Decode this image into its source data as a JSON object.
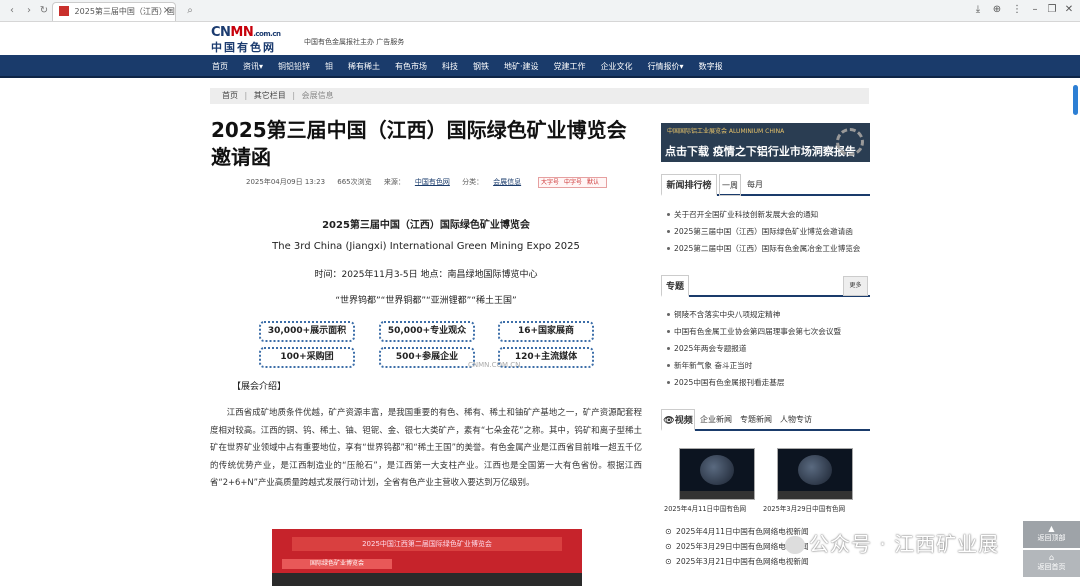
{
  "browser": {
    "tab_title": "2025第三届中国（江西）国际",
    "back_icon": "‹",
    "forward_icon": "›",
    "reload_icon": "↻",
    "search_icon": "⌕",
    "close_tab": "×",
    "download_icon": "⤓",
    "globe_icon": "⊕",
    "menu_icon": "⋮",
    "minimize": "–",
    "restore": "❐",
    "close": "✕"
  },
  "header": {
    "logo_main_a": "CN",
    "logo_main_b": "MN",
    "logo_suffix": ".com.cn",
    "logo_cn": "中国有色网",
    "slogan": "中国有色金属报社主办    广告服务"
  },
  "nav": {
    "items": [
      "首页",
      "资讯▾",
      "铜铝铅锌",
      "钼",
      "稀有稀土",
      "有色市场",
      "科技",
      "钢铁",
      "地矿·建设",
      "党建工作",
      "企业文化",
      "行情报价▾",
      "数字报"
    ]
  },
  "breadcrumb": {
    "home": "首页",
    "sep": "|",
    "section": "其它栏目",
    "current": "会展信息"
  },
  "article": {
    "title": "2025第三届中国（江西）国际绿色矿业博览会邀请函",
    "date": "2025年04月09日 13:23",
    "views": "665次浏览",
    "source_label": "来源：",
    "source": "中国有色网",
    "category_label": "分类：",
    "category": "会展信息",
    "font_large": "大字号",
    "font_mid": "中字号",
    "font_small": "默认",
    "expo_name": "2025第三届中国（江西）国际绿色矿业博览会",
    "expo_en": "The 3rd China (Jiangxi) International Green Mining Expo 2025",
    "time_line": "时间：2025年11月3-5日          地点：南昌绿地国际博览中心",
    "tagline": "“世界钨都”“世界铜都”“亚洲锂都”“稀土王国”",
    "stats": [
      "30,000+展示面积",
      "50,000+专业观众",
      "16+国家展商",
      "100+采购团",
      "500+参展企业",
      "120+主流媒体"
    ],
    "watermark": "CNMN.COM.CN",
    "intro_heading": "【展会介绍】",
    "paragraph": "江西省成矿地质条件优越，矿产资源丰富，是我国重要的有色、稀有、稀土和铀矿产基地之一，矿产资源配套程度相对较高。江西的铜、钨、稀土、铀、钽铌、金、银七大类矿产，素有“七朵金花”之称。其中，钨矿和离子型稀土矿在世界矿业领域中占有重要地位，享有“世界钨都”和“稀土王国”的美誉。有色金属产业是江西省目前唯一超五千亿的传统优势产业，是江西制造业的“压舱石”，是江西第一大支柱产业。江西也是全国第一大有色省份。根据江西省“2+6+N”产业高质量跨越式发展行动计划，全省有色产业主营收入要达到万亿级别。",
    "photo_banner": "2025中国江西第二届国际绿色矿业博览会",
    "photo_sub": "国际绿色矿业博览会"
  },
  "sidebar": {
    "ad_small": "中国国际铝工业展览会 ALUMINIUM CHINA",
    "ad_big": "点击下载 疫情之下铝行业市场洞察报告",
    "ranking": {
      "title": "新闻排行榜",
      "tab_week": "一周",
      "tab_month": "每月",
      "items": [
        "关于召开全国矿业科技创新发展大会的通知",
        "2025第三届中国（江西）国际绿色矿业博览会邀请函",
        "2025第二届中国（江西）国际有色金属冶金工业博览会"
      ]
    },
    "topics": {
      "title": "专题",
      "more": "更多",
      "items": [
        "铜陵不含落实中央八项规定精神",
        "中国有色金属工业协会第四届理事会第七次会议暨",
        "2025年两会专题报道",
        "新年新气象 奋斗正当时",
        "2025中国有色金属报刊看走基层"
      ]
    },
    "video": {
      "tabs": [
        "视频",
        "企业新闻",
        "专题新闻",
        "人物专访"
      ],
      "cap1": "2025年4月11日中国有色网",
      "cap2": "2025年3月29日中国有色网",
      "items": [
        "2025年4月11日中国有色网络电视新闻",
        "2025年3月29日中国有色网络电视新闻",
        "2025年3月21日中国有色网络电视新闻"
      ]
    }
  },
  "overlay": {
    "wechat": "公众号 · 江西矿业展",
    "back_top": "返回顶部",
    "back_home": "返回首页"
  }
}
